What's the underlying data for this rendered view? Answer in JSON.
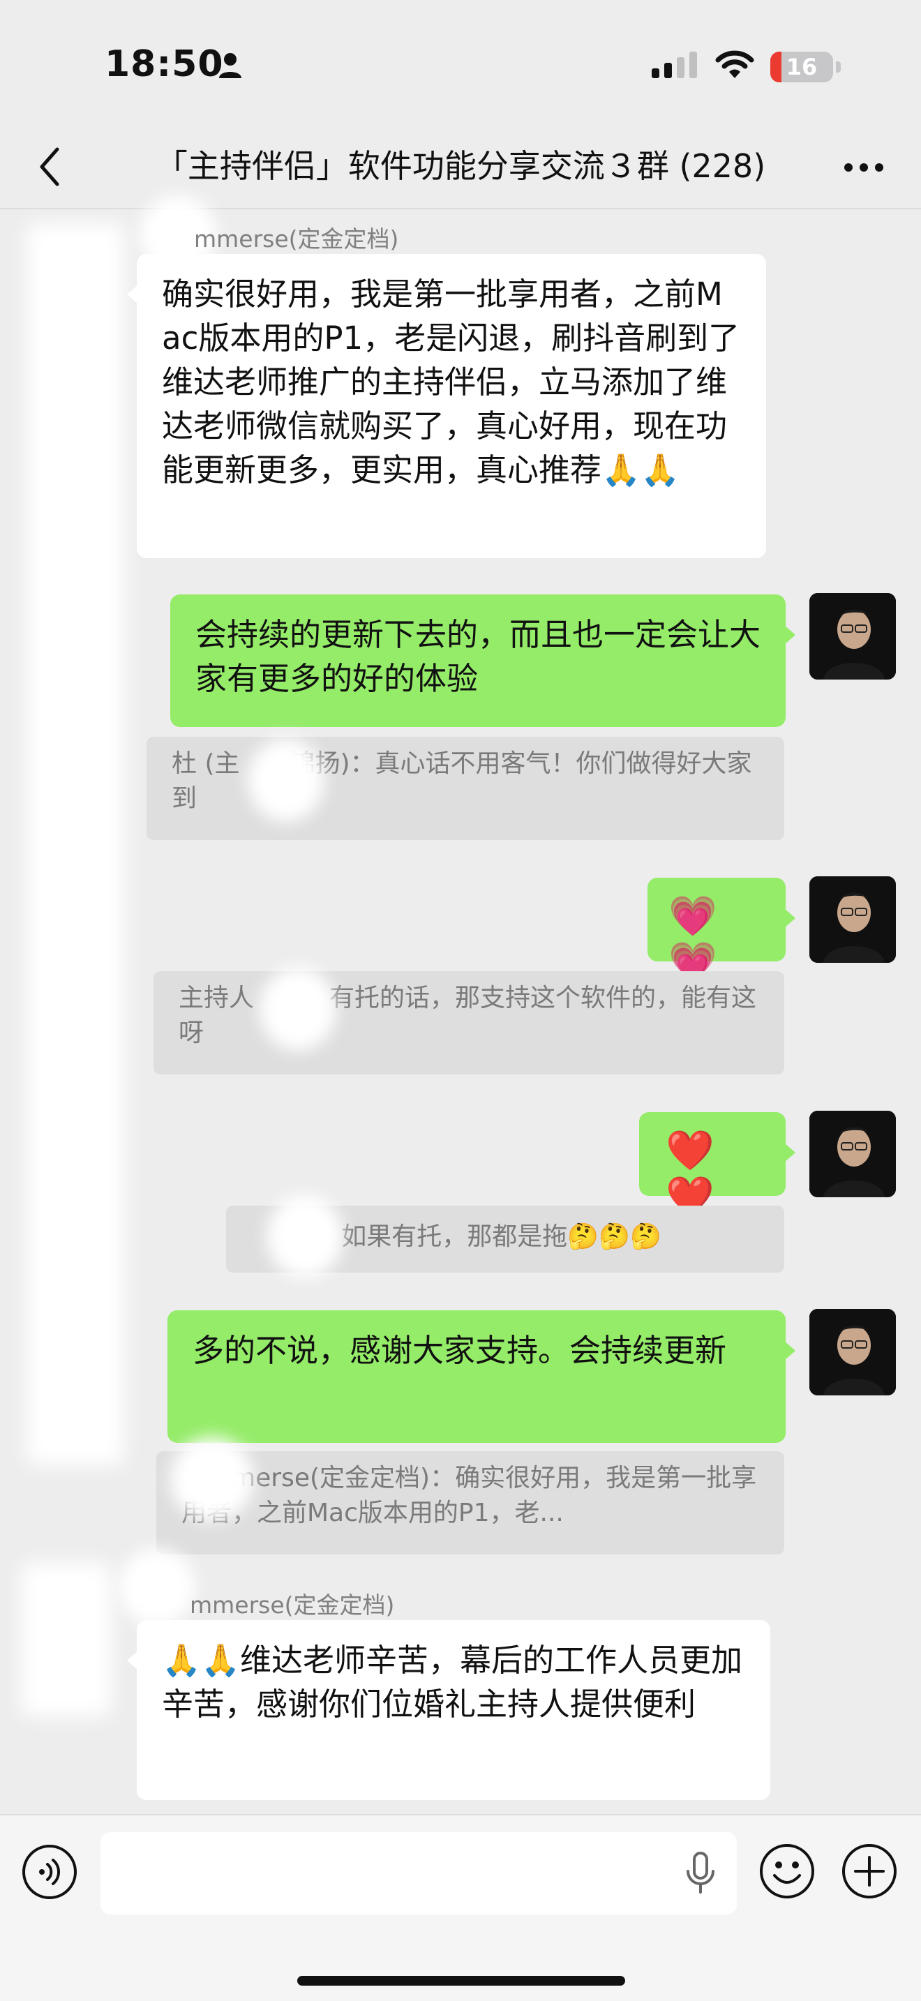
{
  "status_bar": {
    "time": "18:50",
    "battery": "16",
    "signal_bars_active": 2
  },
  "header": {
    "title": "「主持伴侣」软件功能分享交流３群 (228)"
  },
  "messages": {
    "m1": {
      "sender": "mmerse(定金定档)",
      "text": "确实很好用，我是第一批享用者，之前Mac版本用的P1，老是闪退，刷抖音刷到了维达老师推广的主持伴侣，立马添加了维达老师微信就购买了，真心好用，现在功能更新更多，更实用，真心推荐🙏🙏"
    },
    "m2": {
      "text": "会持续的更新下去的，而且也一定会让大家有更多的好的体验",
      "quote": "杜 (主　　锦扬)：真心话不用客气！你们做得好大家　　到"
    },
    "m3": {
      "text": "💗💗",
      "quote": "主持人　　：有托的话，那支持这个软件的，能有这　　呀"
    },
    "m4": {
      "text": "❤️❤️",
      "quote": "　　y：如果有托，那都是拖🤔🤔🤔"
    },
    "m5": {
      "text": "多的不说，感谢大家支持。会持续更新",
      "quote": "　mmerse(定金定档)：确实很好用，我是第一批享用者，之前Mac版本用的P1，老..."
    },
    "m6": {
      "sender": "mmerse(定金定档)",
      "text": "🙏🙏维达老师辛苦，幕后的工作人员更加辛苦，感谢你们位婚礼主持人提供便利"
    }
  },
  "input_bar": {
    "placeholder": ""
  },
  "colors": {
    "bg": "#ededed",
    "green_bubble": "#95ec69",
    "battery_red": "#eb3b31"
  },
  "icons": [
    "person-icon",
    "signal-icon",
    "wifi-icon",
    "battery-icon",
    "back-chevron-icon",
    "more-dots-icon",
    "voice-icon",
    "mic-icon",
    "emoji-icon",
    "plus-icon"
  ]
}
